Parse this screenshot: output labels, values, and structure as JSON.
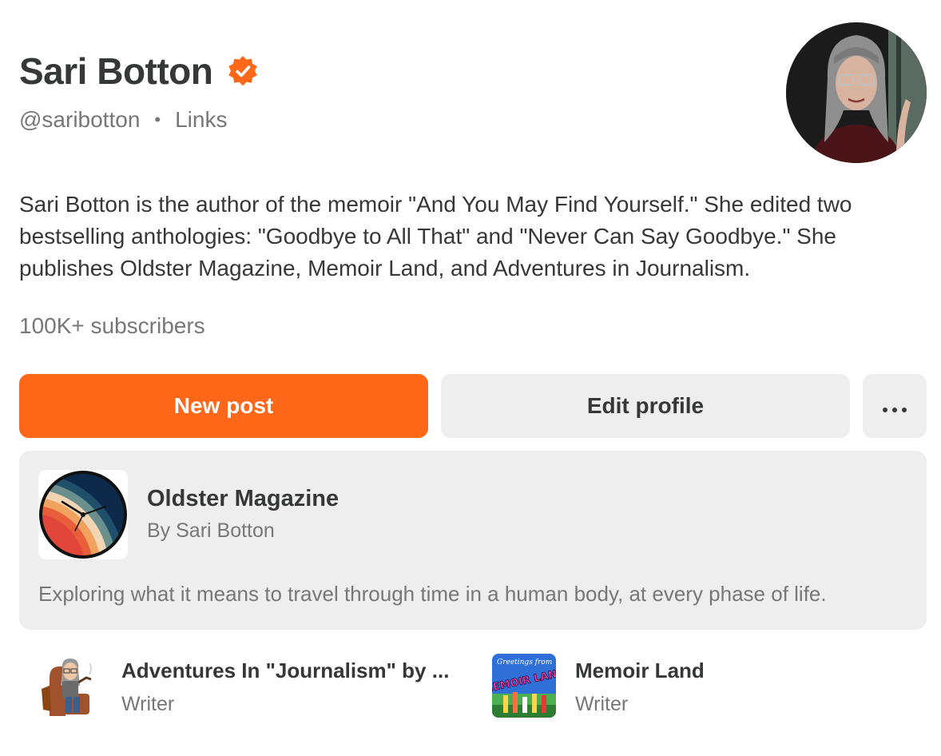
{
  "profile": {
    "name": "Sari Botton",
    "handle": "@saribotton",
    "separator": "•",
    "links_label": "Links",
    "bio": "Sari Botton is the author of the memoir \"And You May Find Yourself.\" She edited two bestselling anthologies: \"Goodbye to All That\" and \"Never Can Say Goodbye.\" She publishes Oldster Magazine, Memoir Land, and Adventures in Journalism.",
    "subscribers": "100K+ subscribers"
  },
  "actions": {
    "new_post": "New post",
    "edit_profile": "Edit profile",
    "more": "•••"
  },
  "featured_publication": {
    "title": "Oldster Magazine",
    "byline": "By Sari Botton",
    "description": "Exploring what it means to travel through time in a human body, at every phase of life."
  },
  "other_publications": [
    {
      "title": "Adventures In \"Journalism\" by ...",
      "role": "Writer",
      "icon": "bitmoji-writer-icon"
    },
    {
      "title": "Memoir Land",
      "role": "Writer",
      "icon": "memoir-land-postcard-icon",
      "icon_text_small": "Greetings from",
      "icon_text_large": "MEMOIR LAND"
    }
  ],
  "colors": {
    "accent": "#ff6719",
    "text_primary": "#363737",
    "text_secondary": "#777777",
    "card_bg": "#eeeeee"
  }
}
